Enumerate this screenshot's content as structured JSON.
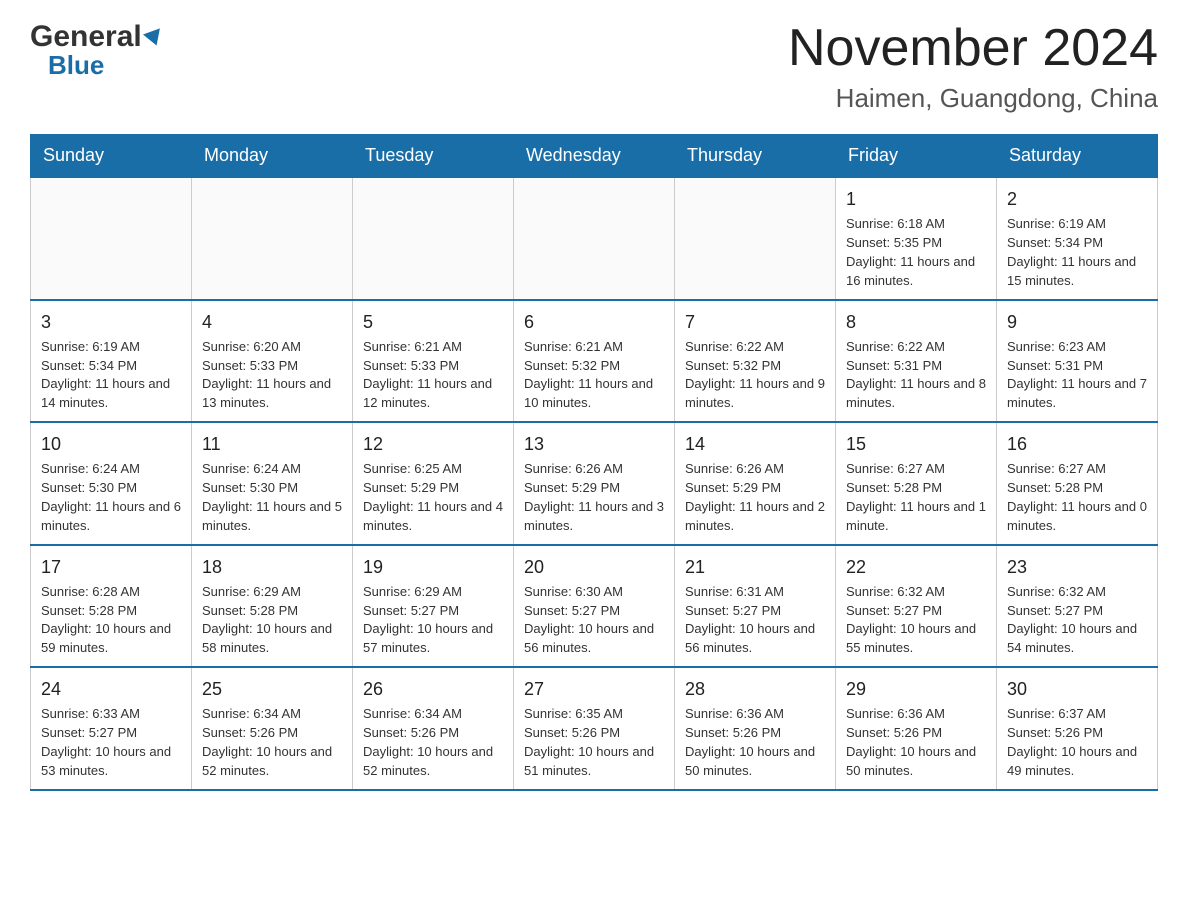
{
  "header": {
    "logo_general": "General",
    "logo_blue": "Blue",
    "main_title": "November 2024",
    "subtitle": "Haimen, Guangdong, China"
  },
  "calendar": {
    "days_of_week": [
      "Sunday",
      "Monday",
      "Tuesday",
      "Wednesday",
      "Thursday",
      "Friday",
      "Saturday"
    ],
    "weeks": [
      [
        {
          "day": "",
          "info": ""
        },
        {
          "day": "",
          "info": ""
        },
        {
          "day": "",
          "info": ""
        },
        {
          "day": "",
          "info": ""
        },
        {
          "day": "",
          "info": ""
        },
        {
          "day": "1",
          "info": "Sunrise: 6:18 AM\nSunset: 5:35 PM\nDaylight: 11 hours and 16 minutes."
        },
        {
          "day": "2",
          "info": "Sunrise: 6:19 AM\nSunset: 5:34 PM\nDaylight: 11 hours and 15 minutes."
        }
      ],
      [
        {
          "day": "3",
          "info": "Sunrise: 6:19 AM\nSunset: 5:34 PM\nDaylight: 11 hours and 14 minutes."
        },
        {
          "day": "4",
          "info": "Sunrise: 6:20 AM\nSunset: 5:33 PM\nDaylight: 11 hours and 13 minutes."
        },
        {
          "day": "5",
          "info": "Sunrise: 6:21 AM\nSunset: 5:33 PM\nDaylight: 11 hours and 12 minutes."
        },
        {
          "day": "6",
          "info": "Sunrise: 6:21 AM\nSunset: 5:32 PM\nDaylight: 11 hours and 10 minutes."
        },
        {
          "day": "7",
          "info": "Sunrise: 6:22 AM\nSunset: 5:32 PM\nDaylight: 11 hours and 9 minutes."
        },
        {
          "day": "8",
          "info": "Sunrise: 6:22 AM\nSunset: 5:31 PM\nDaylight: 11 hours and 8 minutes."
        },
        {
          "day": "9",
          "info": "Sunrise: 6:23 AM\nSunset: 5:31 PM\nDaylight: 11 hours and 7 minutes."
        }
      ],
      [
        {
          "day": "10",
          "info": "Sunrise: 6:24 AM\nSunset: 5:30 PM\nDaylight: 11 hours and 6 minutes."
        },
        {
          "day": "11",
          "info": "Sunrise: 6:24 AM\nSunset: 5:30 PM\nDaylight: 11 hours and 5 minutes."
        },
        {
          "day": "12",
          "info": "Sunrise: 6:25 AM\nSunset: 5:29 PM\nDaylight: 11 hours and 4 minutes."
        },
        {
          "day": "13",
          "info": "Sunrise: 6:26 AM\nSunset: 5:29 PM\nDaylight: 11 hours and 3 minutes."
        },
        {
          "day": "14",
          "info": "Sunrise: 6:26 AM\nSunset: 5:29 PM\nDaylight: 11 hours and 2 minutes."
        },
        {
          "day": "15",
          "info": "Sunrise: 6:27 AM\nSunset: 5:28 PM\nDaylight: 11 hours and 1 minute."
        },
        {
          "day": "16",
          "info": "Sunrise: 6:27 AM\nSunset: 5:28 PM\nDaylight: 11 hours and 0 minutes."
        }
      ],
      [
        {
          "day": "17",
          "info": "Sunrise: 6:28 AM\nSunset: 5:28 PM\nDaylight: 10 hours and 59 minutes."
        },
        {
          "day": "18",
          "info": "Sunrise: 6:29 AM\nSunset: 5:28 PM\nDaylight: 10 hours and 58 minutes."
        },
        {
          "day": "19",
          "info": "Sunrise: 6:29 AM\nSunset: 5:27 PM\nDaylight: 10 hours and 57 minutes."
        },
        {
          "day": "20",
          "info": "Sunrise: 6:30 AM\nSunset: 5:27 PM\nDaylight: 10 hours and 56 minutes."
        },
        {
          "day": "21",
          "info": "Sunrise: 6:31 AM\nSunset: 5:27 PM\nDaylight: 10 hours and 56 minutes."
        },
        {
          "day": "22",
          "info": "Sunrise: 6:32 AM\nSunset: 5:27 PM\nDaylight: 10 hours and 55 minutes."
        },
        {
          "day": "23",
          "info": "Sunrise: 6:32 AM\nSunset: 5:27 PM\nDaylight: 10 hours and 54 minutes."
        }
      ],
      [
        {
          "day": "24",
          "info": "Sunrise: 6:33 AM\nSunset: 5:27 PM\nDaylight: 10 hours and 53 minutes."
        },
        {
          "day": "25",
          "info": "Sunrise: 6:34 AM\nSunset: 5:26 PM\nDaylight: 10 hours and 52 minutes."
        },
        {
          "day": "26",
          "info": "Sunrise: 6:34 AM\nSunset: 5:26 PM\nDaylight: 10 hours and 52 minutes."
        },
        {
          "day": "27",
          "info": "Sunrise: 6:35 AM\nSunset: 5:26 PM\nDaylight: 10 hours and 51 minutes."
        },
        {
          "day": "28",
          "info": "Sunrise: 6:36 AM\nSunset: 5:26 PM\nDaylight: 10 hours and 50 minutes."
        },
        {
          "day": "29",
          "info": "Sunrise: 6:36 AM\nSunset: 5:26 PM\nDaylight: 10 hours and 50 minutes."
        },
        {
          "day": "30",
          "info": "Sunrise: 6:37 AM\nSunset: 5:26 PM\nDaylight: 10 hours and 49 minutes."
        }
      ]
    ]
  }
}
